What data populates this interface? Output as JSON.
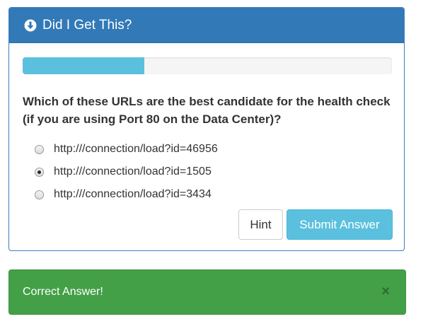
{
  "panel": {
    "title": "Did I Get This?",
    "icon": "arrow-circle-down-icon",
    "accent_color": "#3279b7"
  },
  "progress": {
    "fraction": 0.33,
    "color": "#5bc0de"
  },
  "question": {
    "text": "Which of these URLs are the best candidate for the health check (if you are using Port 80 on the Data Center)?"
  },
  "options": [
    {
      "label": "http:///connection/load?id=46956",
      "checked": false
    },
    {
      "label": "http:///connection/load?id=1505",
      "checked": true
    },
    {
      "label": "http:///connection/load?id=3434",
      "checked": false
    }
  ],
  "buttons": {
    "hint_label": "Hint",
    "submit_label": "Submit Answer"
  },
  "alert": {
    "text": "Correct Answer!",
    "close_label": "×",
    "color": "#43a047"
  }
}
